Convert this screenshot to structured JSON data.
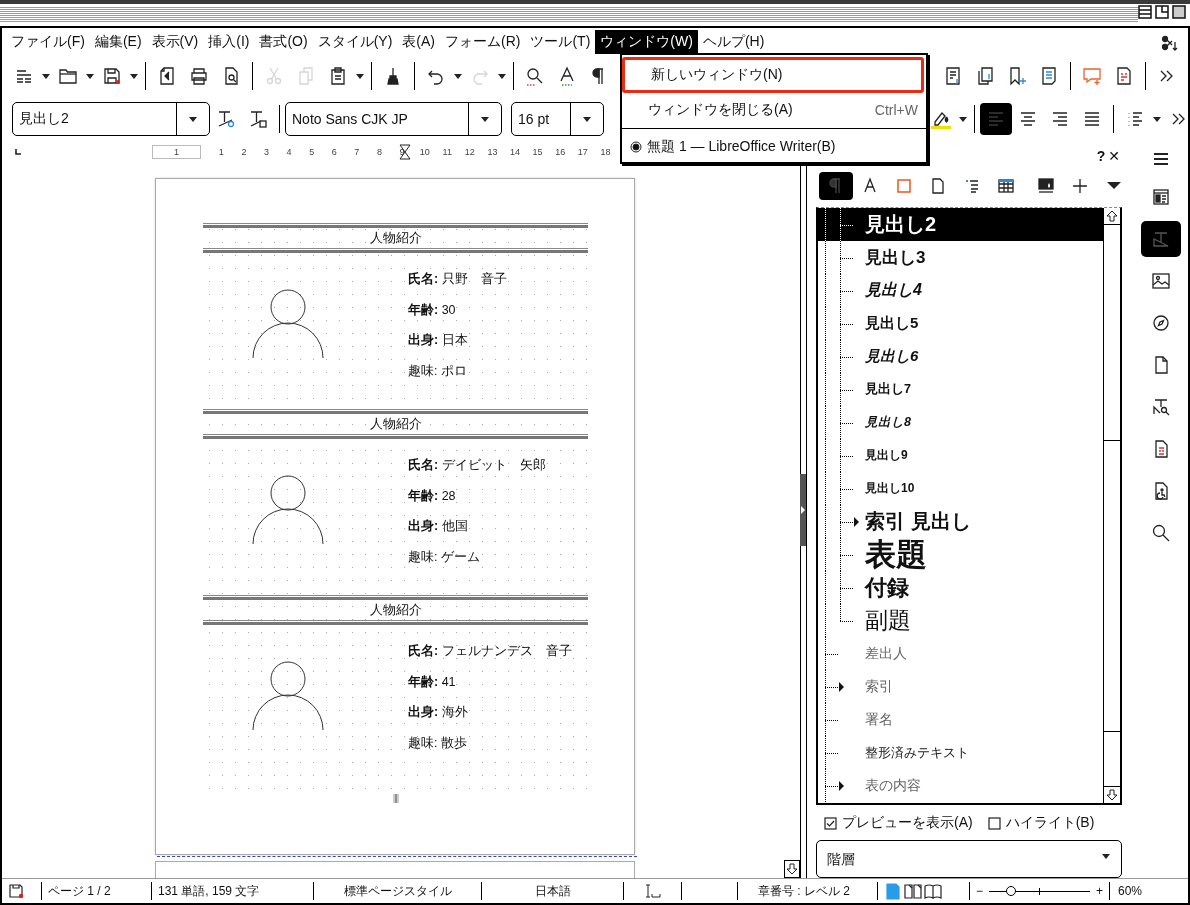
{
  "menu_bar": [
    {
      "label": "ファイル(F)",
      "selected": false
    },
    {
      "label": "編集(E)",
      "selected": false
    },
    {
      "label": "表示(V)",
      "selected": false
    },
    {
      "label": "挿入(I)",
      "selected": false
    },
    {
      "label": "書式(O)",
      "selected": false
    },
    {
      "label": "スタイル(Y)",
      "selected": false
    },
    {
      "label": "表(A)",
      "selected": false
    },
    {
      "label": "フォーム(R)",
      "selected": false
    },
    {
      "label": "ツール(T)",
      "selected": false
    },
    {
      "label": "ウィンドウ(W)",
      "selected": true
    },
    {
      "label": "ヘルプ(H)",
      "selected": false
    }
  ],
  "window_menu": [
    {
      "kind": "command",
      "label": "新しいウィンドウ(N)",
      "selected": true
    },
    {
      "kind": "command",
      "label": "ウィンドウを閉じる(A)",
      "shortcut": "Ctrl+W",
      "selected": false
    },
    {
      "kind": "separator"
    },
    {
      "kind": "window",
      "label": "無題 1 — LibreOffice Writer(B)",
      "selected": false,
      "checked": true
    }
  ],
  "standard_toolbar": [
    {
      "disabled": false
    },
    {
      "disabled": false
    },
    {
      "disabled": false
    },
    {
      "disabled": false
    },
    {
      "disabled": false
    },
    {
      "disabled": false
    },
    {
      "disabled": true
    },
    {
      "disabled": true
    },
    {
      "disabled": false
    },
    {
      "disabled": false
    },
    {
      "disabled": false
    },
    {
      "disabled": true
    },
    {
      "disabled": false
    },
    {
      "disabled": false
    },
    {
      "disabled": false
    },
    {
      "disabled": false
    },
    {
      "disabled": false
    },
    {
      "disabled": false
    },
    {
      "disabled": false
    },
    {
      "disabled": false
    },
    {
      "disabled": false
    },
    {
      "disabled": false
    }
  ],
  "formatting_toolbar": {
    "paragraph_style": "見出し2",
    "font_name": "Noto Sans CJK JP",
    "font_size": "16 pt",
    "alignment": [
      {
        "selected": true
      },
      {
        "selected": false
      },
      {
        "selected": false
      },
      {
        "selected": false
      }
    ]
  },
  "ruler": [
    "1",
    "1",
    "2",
    "3",
    "4",
    "5",
    "6",
    "7",
    "8",
    "9",
    "10",
    "11",
    "12",
    "13",
    "14",
    "15",
    "16",
    "17",
    "18"
  ],
  "document": {
    "cards": [
      {
        "title": "人物紹介",
        "fields": [
          "**氏名:** 只野　音子",
          "**年齢:** 30",
          "**出身:** 日本",
          "趣味: ポロ"
        ]
      },
      {
        "title": "人物紹介",
        "fields": [
          "**氏名:** デイビット　矢郎",
          "**年齢:** 28",
          "**出身:** 他国",
          "趣味: ゲーム"
        ]
      },
      {
        "title": "人物紹介",
        "fields": [
          "**氏名:** フェルナンデス　音子",
          "**年齢:** 41",
          "**出身:** 海外",
          "趣味: 散歩"
        ]
      }
    ]
  },
  "sidebar": {
    "help": "?",
    "close": "✕",
    "style_families": [
      {
        "selected": true
      },
      {
        "selected": false
      },
      {
        "selected": false
      },
      {
        "selected": false
      },
      {
        "selected": false
      },
      {
        "selected": false
      },
      {
        "selected": false
      }
    ],
    "style_tree": [
      {
        "children": [
          {
            "label": "見出し2",
            "kind": "heading2",
            "selected": true,
            "expandable": false
          },
          {
            "label": "見出し3",
            "kind": "heading3",
            "selected": false,
            "expandable": false
          },
          {
            "label": "見出し4",
            "kind": "heading4",
            "selected": false,
            "expandable": false
          },
          {
            "label": "見出し5",
            "kind": "heading5",
            "selected": false,
            "expandable": false
          },
          {
            "label": "見出し6",
            "kind": "heading6",
            "selected": false,
            "expandable": false
          },
          {
            "label": "見出し7",
            "kind": "heading7",
            "selected": false,
            "expandable": false
          },
          {
            "label": "見出し8",
            "kind": "heading8",
            "selected": false,
            "expandable": false
          },
          {
            "label": "見出し9",
            "kind": "heading9",
            "selected": false,
            "expandable": false
          },
          {
            "label": "見出し10",
            "kind": "heading10",
            "selected": false,
            "expandable": false
          },
          {
            "label": "索引 見出し",
            "kind": "index-heading",
            "selected": false,
            "expandable": true,
            "expanded": false
          },
          {
            "label": "表題",
            "kind": "title",
            "selected": false,
            "expandable": false
          },
          {
            "label": "付録",
            "kind": "appendix",
            "selected": false,
            "expandable": false
          },
          {
            "label": "副題",
            "kind": "subtitle",
            "selected": false,
            "expandable": false
          }
        ]
      },
      {
        "label": "差出人",
        "kind": "plain",
        "selected": false,
        "expandable": false
      },
      {
        "label": "索引",
        "kind": "plain",
        "selected": false,
        "expandable": true,
        "expanded": false
      },
      {
        "label": "署名",
        "kind": "plain",
        "selected": false,
        "expandable": false
      },
      {
        "label": "整形済みテキスト",
        "kind": "preformatted",
        "selected": false,
        "expandable": false
      },
      {
        "label": "表の内容",
        "kind": "plain",
        "selected": false,
        "expandable": true,
        "expanded": false
      }
    ],
    "preview_checkbox": {
      "label": "プレビューを表示(A)",
      "checked": true
    },
    "highlight_checkbox": {
      "label": "ハイライト(B)",
      "checked": false
    },
    "filter": {
      "value": "階層"
    }
  },
  "sidebar_tabs": [
    {
      "selected": false
    },
    {
      "selected": true
    },
    {
      "selected": false
    },
    {
      "selected": false
    },
    {
      "selected": false
    },
    {
      "selected": false
    },
    {
      "selected": false
    },
    {
      "selected": false
    },
    {
      "selected": false
    }
  ],
  "status_bar": {
    "document_modified": true,
    "page": "ページ 1 / 2",
    "words": "131 単語, 159 文字",
    "page_style": "標準ページスタイル",
    "language": "日本語",
    "outline_level": "章番号 : レベル 2",
    "layouts": [
      {
        "selected": true
      },
      {
        "selected": false
      },
      {
        "selected": false
      }
    ],
    "zoom_out": "−",
    "zoom_in": "+",
    "zoom": {
      "level": 0.22,
      "reading": "60%"
    }
  }
}
